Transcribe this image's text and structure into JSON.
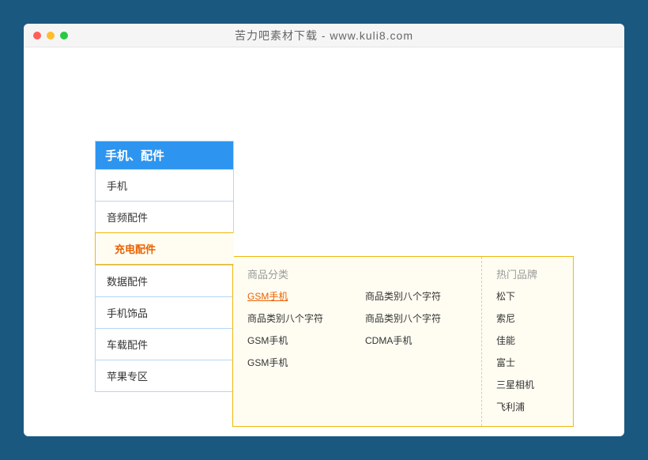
{
  "window": {
    "title": "苦力吧素材下载 - www.kuli8.com"
  },
  "menu": {
    "header": "手机、配件",
    "items": [
      {
        "label": "手机"
      },
      {
        "label": "音频配件"
      },
      {
        "label": "充电配件",
        "active": true
      },
      {
        "label": "数据配件"
      },
      {
        "label": "手机饰品"
      },
      {
        "label": "车载配件"
      },
      {
        "label": "苹果专区"
      }
    ]
  },
  "flyout": {
    "categories_heading": "商品分类",
    "categories": [
      {
        "label": "GSM手机",
        "highlight": true
      },
      {
        "label": "商品类别八个字符"
      },
      {
        "label": "商品类别八个字符"
      },
      {
        "label": "商品类别八个字符"
      },
      {
        "label": "GSM手机"
      },
      {
        "label": "CDMA手机"
      },
      {
        "label": "GSM手机"
      }
    ],
    "brands_heading": "热门品牌",
    "brands": [
      {
        "label": "松下"
      },
      {
        "label": "索尼"
      },
      {
        "label": "佳能"
      },
      {
        "label": "富士"
      },
      {
        "label": "三星相机"
      },
      {
        "label": "飞利浦"
      }
    ]
  }
}
